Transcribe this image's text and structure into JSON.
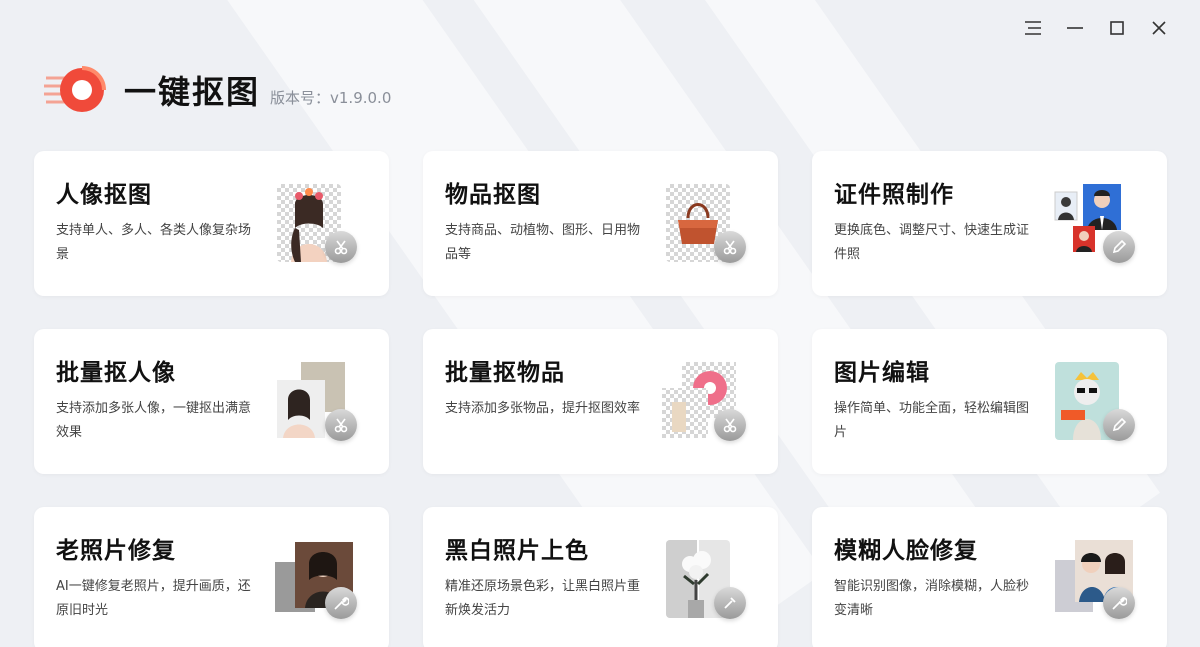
{
  "app": {
    "title": "一键抠图",
    "version": "版本号：v1.9.0.0"
  },
  "window_controls": [
    "menu-icon",
    "minimize-icon",
    "maximize-icon",
    "close-icon"
  ],
  "colors": {
    "brand_red": "#f04a3a",
    "brand_orange": "#ff7a5a",
    "card_bg": "#ffffff",
    "page_bg": "#eef0f4"
  },
  "cards": [
    {
      "title": "人像抠图",
      "desc": "支持单人、多人、各类人像复杂场景",
      "badge_icon": "scissors-icon"
    },
    {
      "title": "物品抠图",
      "desc": "支持商品、动植物、图形、日用物品等",
      "badge_icon": "scissors-icon"
    },
    {
      "title": "证件照制作",
      "desc": "更换底色、调整尺寸、快速生成证件照",
      "badge_icon": "pencil-icon"
    },
    {
      "title": "批量抠人像",
      "desc": "支持添加多张人像，一键抠出满意效果",
      "badge_icon": "scissors-icon"
    },
    {
      "title": "批量抠物品",
      "desc": "支持添加多张物品，提升抠图效率",
      "badge_icon": "scissors-icon"
    },
    {
      "title": "图片编辑",
      "desc": "操作简单、功能全面，轻松编辑图片",
      "badge_icon": "pencil-icon"
    },
    {
      "title": "老照片修复",
      "desc": "AI一键修复老照片，提升画质，还原旧时光",
      "badge_icon": "wrench-icon"
    },
    {
      "title": "黑白照片上色",
      "desc": "精准还原场景色彩，让黑白照片重新焕发活力",
      "badge_icon": "brush-icon"
    },
    {
      "title": "模糊人脸修复",
      "desc": "智能识别图像，消除模糊，人脸秒变清晰",
      "badge_icon": "wrench-icon"
    }
  ]
}
